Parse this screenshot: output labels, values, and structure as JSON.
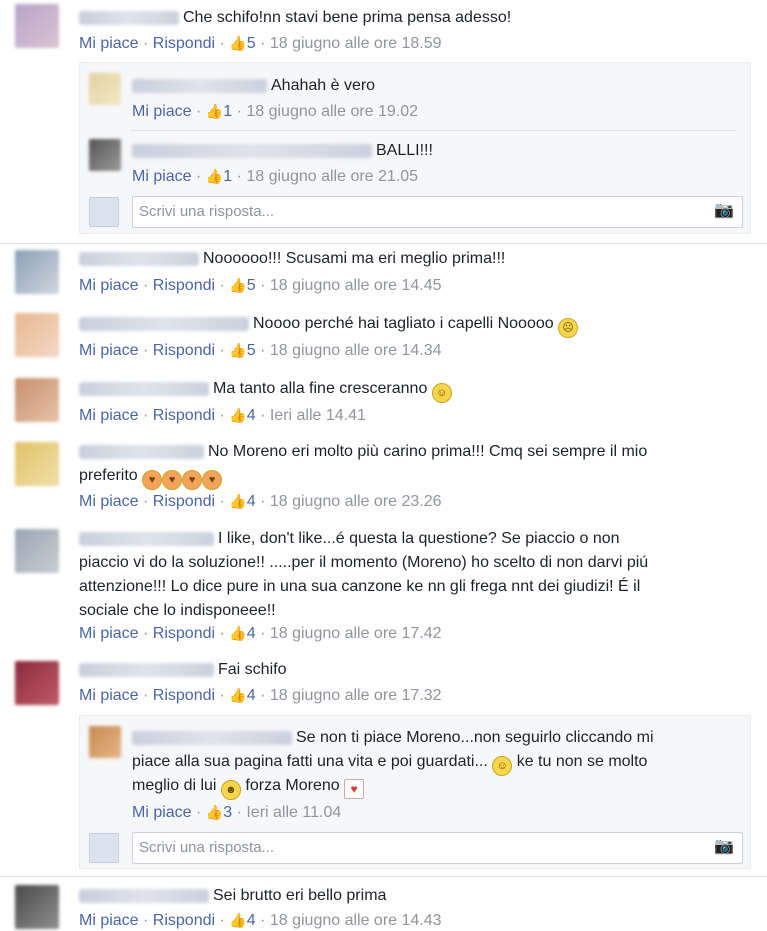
{
  "labels": {
    "like": "Mi piace",
    "reply": "Rispondi",
    "write_reply": "Scrivi una risposta..."
  },
  "comments": [
    {
      "text": "Che schifo!nn stavi bene prima pensa adesso!",
      "likes": "5",
      "time": "18 giugno alle ore 18.59",
      "replies": [
        {
          "text": "Ahahah è vero",
          "likes": "1",
          "time": "18 giugno alle ore 19.02"
        },
        {
          "text": "BALLI!!!",
          "likes": "1",
          "time": "18 giugno alle ore 21.05"
        }
      ]
    },
    {
      "text": "Noooooo!!! Scusami ma eri meglio prima!!!",
      "likes": "5",
      "time": "18 giugno alle ore 14.45"
    },
    {
      "text": "Noooo perché hai tagliato i capelli Nooooo",
      "likes": "5",
      "time": "18 giugno alle ore 14.34"
    },
    {
      "text": "Ma tanto alla fine cresceranno",
      "likes": "4",
      "time": "Ieri alle 14.41"
    },
    {
      "text_line1": "No Moreno eri molto più carino prima!!! Cmq sei sempre il mio",
      "text_line2": "preferito",
      "likes": "4",
      "time": "18 giugno alle ore 23.26"
    },
    {
      "text_line1": "I like, don't like...é questa la questione? Se piaccio o non",
      "text_line2": "piaccio vi do la soluzione!! .....per il momento (Moreno) ho scelto di non darvi piú",
      "text_line3": "attenzione!!! Lo dice pure in una sua canzone ke nn gli frega nnt dei giudizi! É il",
      "text_line4": "sociale che lo indisponeee!!",
      "likes": "4",
      "time": "18 giugno alle ore 17.42"
    },
    {
      "text": "Fai schifo",
      "likes": "4",
      "time": "18 giugno alle ore 17.32",
      "replies": [
        {
          "text_line1": "Se non ti piace Moreno...non seguirlo cliccando mi",
          "text_line2": "piace alla sua pagina fatti una vita e poi guardati...",
          "text_line2b": "ke tu non se molto",
          "text_line3a": "meglio di lui",
          "text_line3b": "forza Moreno",
          "likes": "3",
          "time": "Ieri alle 11.04"
        }
      ]
    },
    {
      "text": "Sei brutto eri bello prima",
      "likes": "4",
      "time": "18 giugno alle ore 14.43"
    }
  ]
}
